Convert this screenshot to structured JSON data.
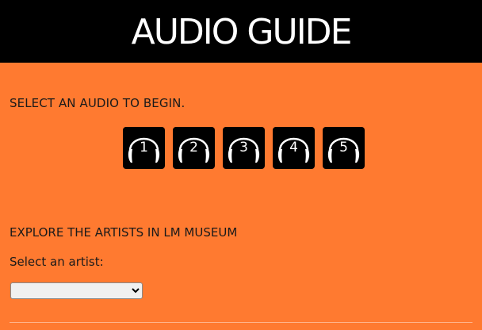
{
  "header": {
    "title": "AUDIO GUIDE"
  },
  "intro": {
    "text": "SELECT AN AUDIO TO BEGIN."
  },
  "audio_buttons": [
    {
      "label": "1",
      "icon": "headphones-icon"
    },
    {
      "label": "2",
      "icon": "headphones-icon"
    },
    {
      "label": "3",
      "icon": "headphones-icon"
    },
    {
      "label": "4",
      "icon": "headphones-icon"
    },
    {
      "label": "5",
      "icon": "headphones-icon"
    }
  ],
  "explore": {
    "heading": "EXPLORE THE ARTISTS IN LM MUSEUM",
    "select_label": "Select an artist:",
    "selected_value": ""
  },
  "colors": {
    "background": "#ff7a30",
    "header": "#000000",
    "header_text": "#ffffff",
    "button": "#000000"
  }
}
